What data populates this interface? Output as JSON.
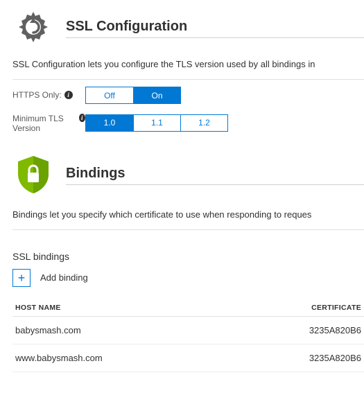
{
  "ssl_config": {
    "title": "SSL Configuration",
    "description": "SSL Configuration lets you configure the TLS version used by all bindings in",
    "https_only_label": "HTTPS Only:",
    "https_only_off": "Off",
    "https_only_on": "On",
    "https_only_selected": "On",
    "min_tls_label": "Minimum TLS Version",
    "min_tls_options": [
      "1.0",
      "1.1",
      "1.2"
    ],
    "min_tls_selected": "1.0"
  },
  "bindings": {
    "title": "Bindings",
    "description": "Bindings let you specify which certificate to use when responding to reques",
    "sub_heading": "SSL bindings",
    "add_label": "Add binding",
    "columns": {
      "host": "HOST NAME",
      "cert": "CERTIFICATE"
    },
    "rows": [
      {
        "host": "babysmash.com",
        "cert": "3235A820B6"
      },
      {
        "host": "www.babysmash.com",
        "cert": "3235A820B6"
      }
    ]
  }
}
